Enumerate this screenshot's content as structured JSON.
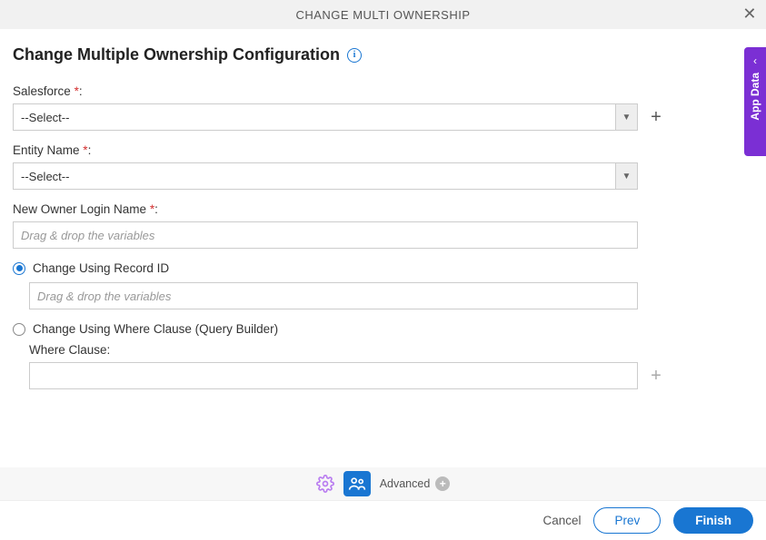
{
  "header": {
    "title": "CHANGE MULTI OWNERSHIP"
  },
  "page": {
    "title": "Change Multiple Ownership Configuration"
  },
  "sideTab": {
    "label": "App Data"
  },
  "fields": {
    "salesforce": {
      "label": "Salesforce",
      "required_colon": ":",
      "placeholder": "--Select--"
    },
    "entity": {
      "label": "Entity Name",
      "required_colon": ":",
      "placeholder": "--Select--"
    },
    "newOwner": {
      "label": "New Owner Login Name",
      "required_colon": ":",
      "placeholder": "Drag & drop the variables"
    },
    "radioRecord": {
      "label": "Change Using Record ID",
      "placeholder": "Drag & drop the variables"
    },
    "radioWhere": {
      "label": "Change Using Where Clause (Query Builder)",
      "whereLabel": "Where Clause:"
    }
  },
  "toolbar": {
    "advanced": "Advanced"
  },
  "footer": {
    "cancel": "Cancel",
    "prev": "Prev",
    "finish": "Finish"
  },
  "required_star": "*"
}
